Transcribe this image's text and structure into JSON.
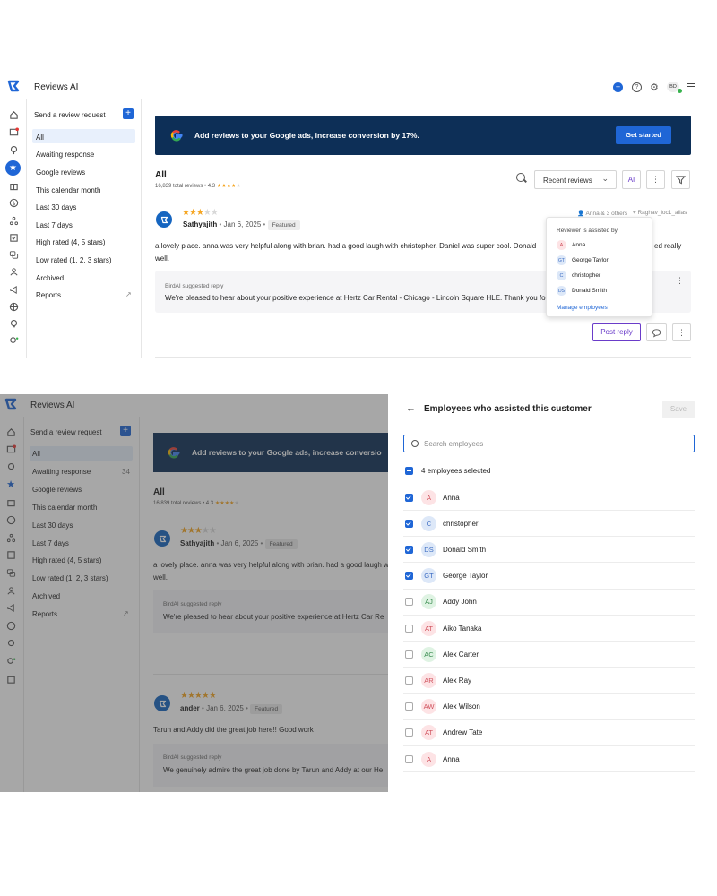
{
  "top": {
    "app_title": "Reviews AI",
    "user_initials": "BD",
    "send_request_label": "Send a review request",
    "nav": [
      {
        "label": "All"
      },
      {
        "label": "Awaiting response"
      },
      {
        "label": "Google reviews"
      },
      {
        "label": "This calendar month"
      },
      {
        "label": "Last 30 days"
      },
      {
        "label": "Last 7 days"
      },
      {
        "label": "High rated (4, 5 stars)"
      },
      {
        "label": "Low rated (1, 2, 3 stars)"
      },
      {
        "label": "Archived"
      },
      {
        "label": "Reports"
      }
    ],
    "banner": {
      "text": "Add reviews to your Google ads, increase conversion by 17%.",
      "button": "Get started"
    },
    "list_title": "All",
    "list_meta": "16,839 total reviews • 4.3",
    "sort_label": "Recent reviews",
    "ai_label": "AI",
    "review": {
      "author": "Sathyajith",
      "date": "Jan 6, 2025",
      "badge": "Featured",
      "rating": 3,
      "assisted_meta": "Anna & 3 others",
      "location_meta": "Raghav_loc1_alias",
      "body_line1": "a lovely place. anna was very helpful along with brian. had a good laugh with christopher. Daniel was super cool. Donald",
      "body_tail": "ed really",
      "body_line2": "well.",
      "suggest_label": "BirdAI suggested reply",
      "suggest_text": "We're pleased to hear about your positive experience at Hertz Car Rental - Chicago - Lincoln Square HLE. Thank you fo",
      "post_reply": "Post reply"
    },
    "popover": {
      "title": "Reviewer is assisted by",
      "people": [
        {
          "initials": "A",
          "name": "Anna"
        },
        {
          "initials": "GT",
          "name": "George Taylor"
        },
        {
          "initials": "C",
          "name": "christopher"
        },
        {
          "initials": "DS",
          "name": "Donald Smith"
        }
      ],
      "manage": "Manage employees"
    }
  },
  "bottom": {
    "app_title": "Reviews AI",
    "send_request_label": "Send a review request",
    "nav": [
      {
        "label": "All",
        "count": ""
      },
      {
        "label": "Awaiting response",
        "count": "34"
      },
      {
        "label": "Google reviews",
        "count": ""
      },
      {
        "label": "This calendar month",
        "count": ""
      },
      {
        "label": "Last 30 days",
        "count": ""
      },
      {
        "label": "Last 7 days",
        "count": ""
      },
      {
        "label": "High rated (4, 5 stars)",
        "count": ""
      },
      {
        "label": "Low rated (1, 2, 3 stars)",
        "count": ""
      },
      {
        "label": "Archived",
        "count": ""
      },
      {
        "label": "Reports",
        "count": ""
      }
    ],
    "banner_text": "Add reviews to your Google ads, increase conversio",
    "list_title": "All",
    "list_meta": "16,839 total reviews • 4.3",
    "review1": {
      "author": "Sathyajith",
      "date": "Jan 6, 2025",
      "badge": "Featured",
      "rating": 3,
      "body": "a lovely place. anna was very helpful along with brian. had a good laugh with christopher. Daniel was super cool. Dona",
      "body2": "well.",
      "suggest_label": "BirdAI suggested reply",
      "suggest_text": "We're pleased to hear about your positive experience at Hertz Car Re"
    },
    "review2": {
      "author": "ander",
      "date": "Jan 6, 2025",
      "badge": "Featured",
      "rating": 5,
      "body": "Tarun and Addy did the great job here!! Good work",
      "suggest_label": "BirdAI suggested reply",
      "suggest_text": "We genuinely admire the great job done by Tarun and Addy at our He"
    },
    "panel": {
      "title": "Employees who assisted this customer",
      "save": "Save",
      "search_placeholder": "Search employees",
      "selected_label": "4 employees selected",
      "employees": [
        {
          "initials": "A",
          "name": "Anna",
          "checked": true,
          "color": "pink"
        },
        {
          "initials": "C",
          "name": "christopher",
          "checked": true,
          "color": "blue"
        },
        {
          "initials": "DS",
          "name": "Donald Smith",
          "checked": true,
          "color": "blue"
        },
        {
          "initials": "GT",
          "name": "George Taylor",
          "checked": true,
          "color": "blue"
        },
        {
          "initials": "AJ",
          "name": "Addy John",
          "checked": false,
          "color": "green"
        },
        {
          "initials": "AT",
          "name": "Aiko Tanaka",
          "checked": false,
          "color": "pink"
        },
        {
          "initials": "AC",
          "name": "Alex Carter",
          "checked": false,
          "color": "green"
        },
        {
          "initials": "AR",
          "name": "Alex Ray",
          "checked": false,
          "color": "pink"
        },
        {
          "initials": "AW",
          "name": "Alex Wilson",
          "checked": false,
          "color": "pink"
        },
        {
          "initials": "AT",
          "name": "Andrew Tate",
          "checked": false,
          "color": "pink"
        },
        {
          "initials": "A",
          "name": "Anna",
          "checked": false,
          "color": "pink"
        }
      ]
    }
  },
  "colors": {
    "accent": "#1f66d6",
    "banner": "#0d2f57",
    "star": "#f5a623",
    "post_reply": "#6a3cc9"
  }
}
